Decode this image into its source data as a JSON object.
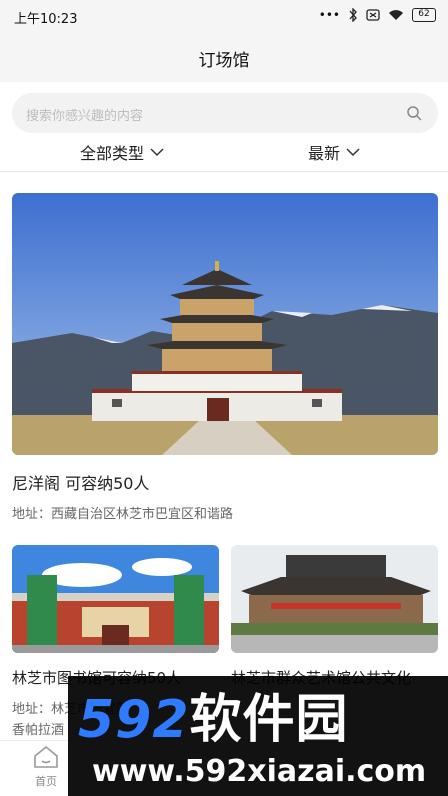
{
  "status_bar": {
    "time": "上午10:23",
    "battery": "62"
  },
  "header": {
    "title": "订场馆"
  },
  "search": {
    "placeholder": "搜索你感兴趣的内容"
  },
  "filters": {
    "type_label": "全部类型",
    "sort_label": "最新"
  },
  "venues": [
    {
      "name": "尼洋阁 可容纳50人",
      "address": "地址：西藏自治区林芝市巴宜区和谐路"
    },
    {
      "name": "林芝市图书馆可容纳50人",
      "address": "地址：林芝市巴宜区",
      "address_line2": "香帕拉酒"
    },
    {
      "name": "林芝市群众艺术馆公共文化",
      "address": ""
    }
  ],
  "tab_bar": {
    "home_label": "首页"
  },
  "watermark": {
    "number": "592",
    "brand": "软件园",
    "url": "www.592xiazai.com"
  },
  "colors": {
    "accent": "#2f7bff",
    "background": "#ffffff",
    "header_bg": "#f5f5f5"
  },
  "icons": [
    "bluetooth-icon",
    "wifi-icon",
    "battery-icon",
    "search-icon",
    "chevron-down-icon",
    "home-icon"
  ]
}
